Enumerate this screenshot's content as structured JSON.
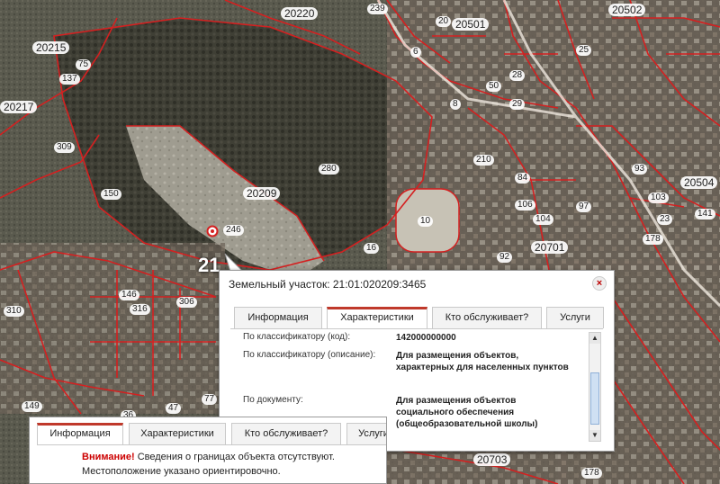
{
  "map": {
    "selected_parcel_code": "21",
    "labels": [
      "20220",
      "20501",
      "20502",
      "20215",
      "75",
      "137",
      "20217",
      "309",
      "150",
      "280",
      "20209",
      "246",
      "10",
      "20",
      "210",
      "8",
      "6",
      "50",
      "28",
      "29",
      "239",
      "25",
      "20504",
      "93",
      "103",
      "23",
      "141",
      "97",
      "84",
      "104",
      "106",
      "20701",
      "92",
      "16",
      "178",
      "306",
      "316",
      "146",
      "310",
      "149",
      "77",
      "47",
      "36",
      "20703",
      "178"
    ]
  },
  "popup": {
    "title": "Земельный участок: 21:01:020209:3465",
    "close_symbol": "×",
    "tabs": [
      "Информация",
      "Характеристики",
      "Кто обслуживает?",
      "Услуги"
    ],
    "active_tab": "Характеристики",
    "rows": [
      {
        "key": "По классификатору (код):",
        "value": "142000000000"
      },
      {
        "key": "По классификатору (описание):",
        "value": "Для размещения объектов, характерных для населенных пунктов"
      },
      {
        "key": "По документу:",
        "value": "Для размещения объектов социального обеспечения (общеобразовательной школы)"
      }
    ],
    "scroll_up": "▲",
    "scroll_down": "▼"
  },
  "info_panel": {
    "tabs": [
      "Информация",
      "Характеристики",
      "Кто обслуживает?",
      "Услуги"
    ],
    "active_tab": "Информация",
    "warning_label": "Внимание!",
    "warning_text": "Сведения о границах объекта отсутствуют.",
    "line2": "Местоположение указано ориентировочно."
  },
  "colors": {
    "boundary": "#d42020",
    "tab_accent": "#c0392b",
    "warning": "#cc0000"
  },
  "icons": {
    "marker": "location-marker-icon",
    "close": "close-icon"
  }
}
